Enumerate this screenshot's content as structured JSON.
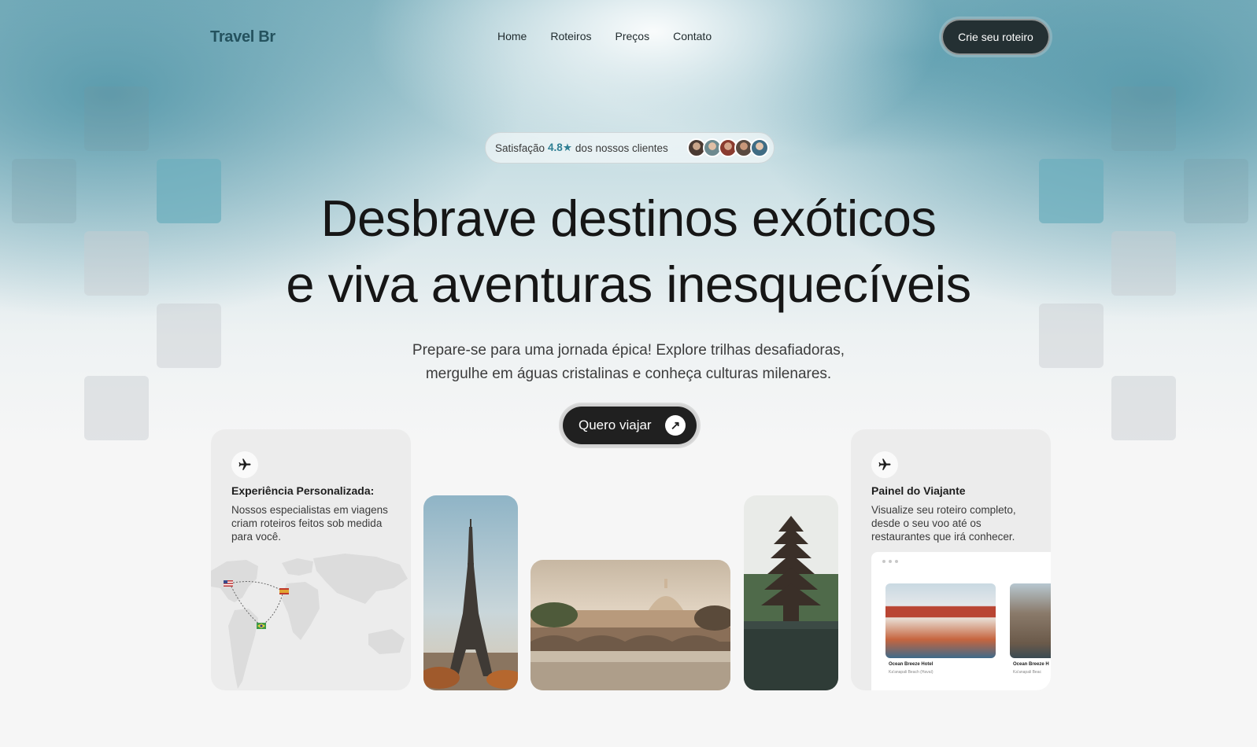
{
  "nav": {
    "logo": "Travel Br",
    "links": [
      "Home",
      "Roteiros",
      "Preços",
      "Contato"
    ],
    "cta": "Crie seu roteiro"
  },
  "rating": {
    "prefix": "Satisfação",
    "score": "4.8★",
    "suffix": "dos nossos clientes"
  },
  "hero": {
    "title_line1": "Desbrave destinos exóticos",
    "title_line2": "e viva aventuras inesquecíveis",
    "subtitle_line1": "Prepare-se para uma jornada épica! Explore trilhas desafiadoras,",
    "subtitle_line2": "mergulhe em águas cristalinas e conheça culturas milenares.",
    "cta": "Quero viajar"
  },
  "cards": {
    "left": {
      "title": "Experiência Personalizada:",
      "text": "Nossos especialistas em viagens criam roteiros feitos sob medida para você."
    },
    "right": {
      "title": "Painel do Viajante",
      "text": "Visualize seu roteiro completo, desde o seu voo até os restaurantes que irá conhecer.",
      "hotels": [
        {
          "name": "Ocean Breeze Hotel",
          "location": "Ka'anapali Beach (Havaí)"
        },
        {
          "name": "Ocean Breeze H",
          "location": "Ka'anapali Beac"
        }
      ]
    }
  },
  "colors": {
    "brand": "#24525e",
    "accent": "#2f7f93",
    "dark_button": "#202020"
  }
}
